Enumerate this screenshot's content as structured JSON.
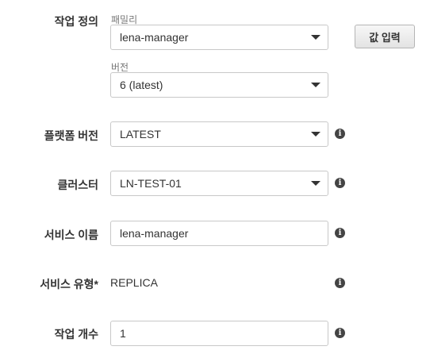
{
  "task_definition": {
    "label": "작업 정의",
    "family_label": "패밀리",
    "family_value": "lena-manager",
    "version_label": "버전",
    "version_value": "6 (latest)",
    "enter_value_button": "값 입력"
  },
  "platform_version": {
    "label": "플랫폼 버전",
    "value": "LATEST"
  },
  "cluster": {
    "label": "클러스터",
    "value": "LN-TEST-01"
  },
  "service_name": {
    "label": "서비스 이름",
    "value": "lena-manager"
  },
  "service_type": {
    "label": "서비스 유형*",
    "value": "REPLICA"
  },
  "task_count": {
    "label": "작업 개수",
    "value": "1"
  },
  "info_icon_glyph": "i"
}
